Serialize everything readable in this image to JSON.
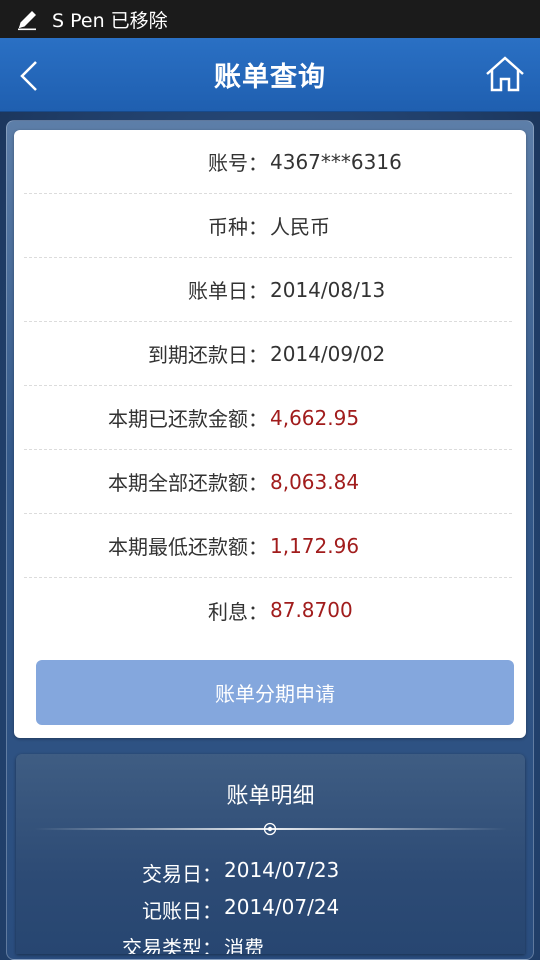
{
  "status_bar": {
    "notice": "S Pen 已移除"
  },
  "nav": {
    "title": "账单查询"
  },
  "summary": {
    "rows": [
      {
        "label": "账号：",
        "value": "4367***6316",
        "highlight": false
      },
      {
        "label": "币种：",
        "value": "人民币",
        "highlight": false
      },
      {
        "label": "账单日：",
        "value": "2014/08/13",
        "highlight": false
      },
      {
        "label": "到期还款日：",
        "value": "2014/09/02",
        "highlight": false
      },
      {
        "label": "本期已还款金额：",
        "value": "4,662.95",
        "highlight": true
      },
      {
        "label": "本期全部还款额：",
        "value": "8,063.84",
        "highlight": true
      },
      {
        "label": "本期最低还款额：",
        "value": "1,172.96",
        "highlight": true
      },
      {
        "label": "利息：",
        "value": "87.8700",
        "highlight": true
      }
    ],
    "apply_button": "账单分期申请"
  },
  "detail": {
    "title": "账单明细",
    "rows": [
      {
        "label": "交易日：",
        "value": "2014/07/23"
      },
      {
        "label": "记账日：",
        "value": "2014/07/24"
      },
      {
        "label": "交易类型：",
        "value": "消费"
      }
    ]
  },
  "colors": {
    "nav_bg": "#2a70c4",
    "amount_red": "#a11c1c",
    "button_bg": "#84a7dd"
  }
}
